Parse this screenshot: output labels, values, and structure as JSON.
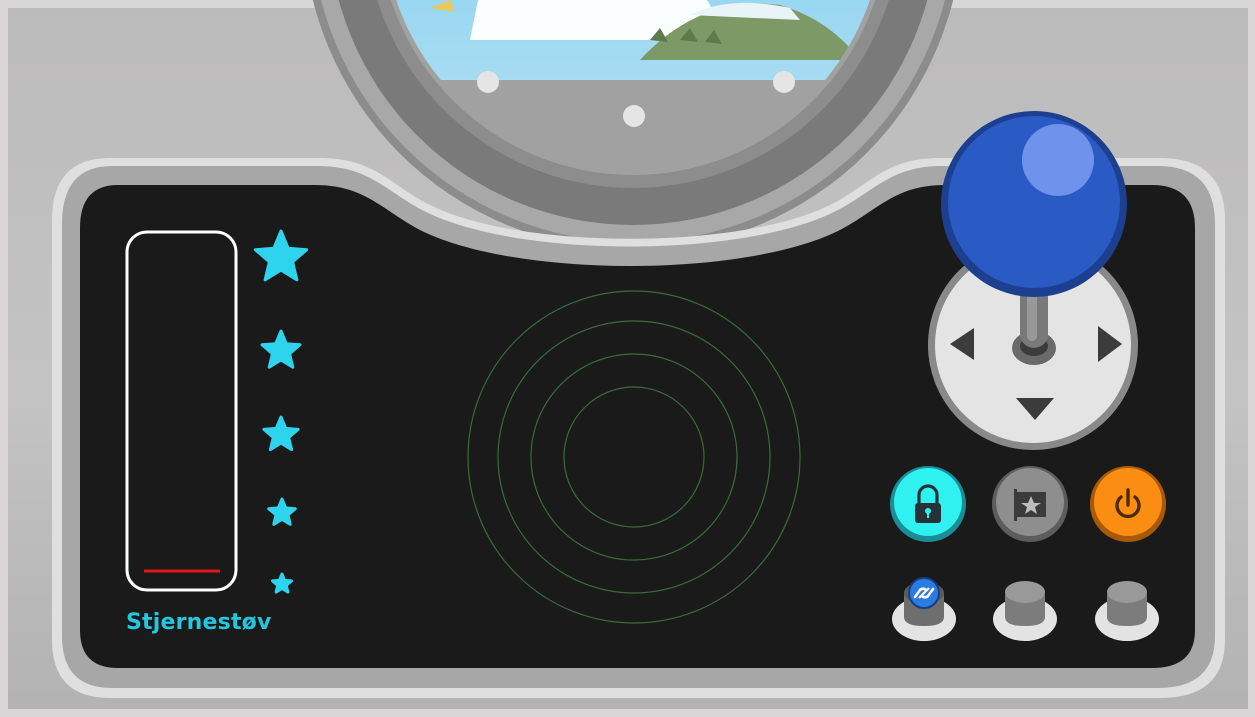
{
  "meter": {
    "label": "Stjernestøv",
    "level": 0.03,
    "level_color": "#e01818",
    "star_color": "#2ed3ee"
  },
  "buttons": [
    {
      "name": "lock-button",
      "icon": "lock-icon",
      "color": "#2ff1ef"
    },
    {
      "name": "flag-button",
      "icon": "star-flag-icon",
      "color": "#8e8e8e"
    },
    {
      "name": "power-button",
      "icon": "power-icon",
      "color": "#fb8d13"
    }
  ],
  "joystick": {
    "knob_color": "#2a5bc4",
    "directions": [
      "left",
      "right",
      "down"
    ]
  },
  "colors": {
    "panel": "#1a1a1a",
    "radar_ring": "#3a6b3a",
    "hull": "#c0bfbf"
  }
}
